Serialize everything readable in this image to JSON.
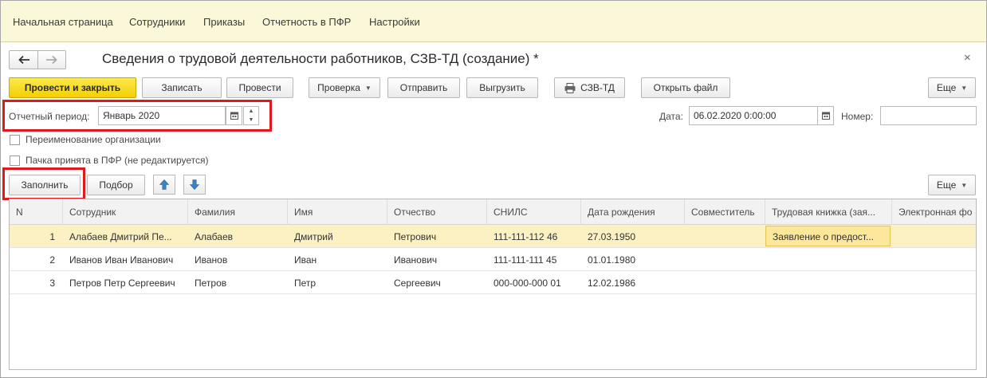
{
  "topnav": {
    "items": [
      "Начальная страница",
      "Сотрудники",
      "Приказы",
      "Отчетность в ПФР",
      "Настройки"
    ]
  },
  "header": {
    "title": "Сведения о трудовой деятельности работников, СЗВ-ТД (создание) *",
    "close": "×"
  },
  "toolbar": {
    "post_close": "Провести и закрыть",
    "write": "Записать",
    "post": "Провести",
    "check": "Проверка",
    "send": "Отправить",
    "upload": "Выгрузить",
    "print_szv": "СЗВ-ТД",
    "open_file": "Открыть файл",
    "more": "Еще"
  },
  "form": {
    "period_label": "Отчетный период:",
    "period_value": "Январь 2020",
    "date_label": "Дата:",
    "date_value": "06.02.2020  0:00:00",
    "number_label": "Номер:",
    "number_value": "",
    "rename_org": "Переименование организации",
    "pack_accepted": "Пачка принята в ПФР (не редактируется)"
  },
  "table_toolbar": {
    "fill": "Заполнить",
    "pick": "Подбор",
    "more": "Еще"
  },
  "table": {
    "columns": [
      "N",
      "Сотрудник",
      "Фамилия",
      "Имя",
      "Отчество",
      "СНИЛС",
      "Дата рождения",
      "Совместитель",
      "Трудовая книжка (зая...",
      "Электронная фо"
    ],
    "rows": [
      [
        "1",
        "Алабаев Дмитрий Пе...",
        "Алабаев",
        "Дмитрий",
        "Петрович",
        "111-111-112 46",
        "27.03.1950",
        "",
        "Заявление о предост...",
        ""
      ],
      [
        "2",
        "Иванов Иван Иванович",
        "Иванов",
        "Иван",
        "Иванович",
        "111-111-111 45",
        "01.01.1980",
        "",
        "",
        ""
      ],
      [
        "3",
        "Петров Петр Сергеевич",
        "Петров",
        "Петр",
        "Сергеевич",
        "000-000-000 01",
        "12.02.1986",
        "",
        "",
        ""
      ]
    ]
  }
}
